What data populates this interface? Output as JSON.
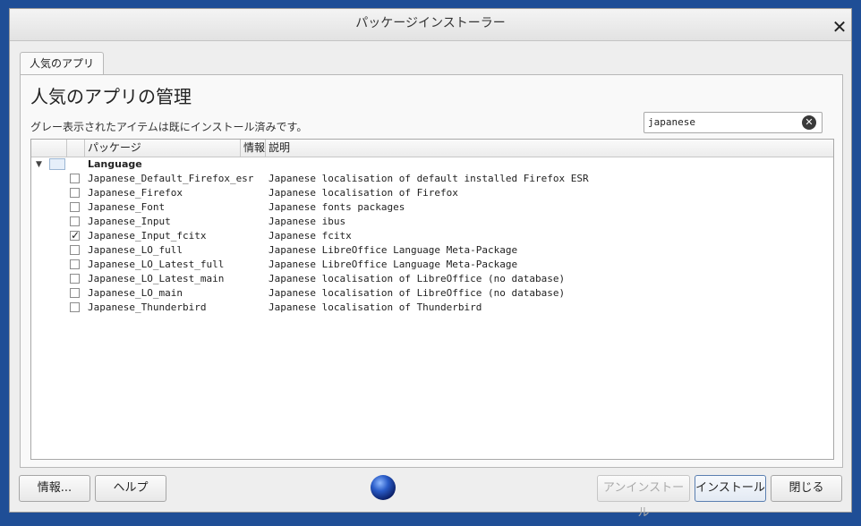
{
  "window": {
    "title": "パッケージインストーラー",
    "close_glyph": "✕"
  },
  "tab": {
    "label": "人気のアプリ"
  },
  "panel": {
    "heading": "人気のアプリの管理",
    "note": "グレー表示されたアイテムは既にインストール済みです。"
  },
  "search": {
    "value": "japanese",
    "clear_icon": "clear-icon"
  },
  "table": {
    "columns": {
      "package": "パッケージ",
      "info": "情報",
      "description": "説明"
    },
    "group": {
      "label": "Language",
      "expanded": true
    },
    "rows": [
      {
        "name": "Japanese_Default_Firefox_esr",
        "desc": "Japanese localisation of default installed Firefox ESR",
        "checked": false
      },
      {
        "name": "Japanese_Firefox",
        "desc": "Japanese localisation of Firefox",
        "checked": false
      },
      {
        "name": "Japanese_Font",
        "desc": "Japanese fonts packages",
        "checked": false
      },
      {
        "name": "Japanese_Input",
        "desc": "Japanese ibus",
        "checked": false
      },
      {
        "name": "Japanese_Input_fcitx",
        "desc": "Japanese fcitx",
        "checked": true
      },
      {
        "name": "Japanese_LO_full",
        "desc": "Japanese LibreOffice Language Meta-Package",
        "checked": false
      },
      {
        "name": "Japanese_LO_Latest_full",
        "desc": "Japanese LibreOffice Language Meta-Package",
        "checked": false
      },
      {
        "name": "Japanese_LO_Latest_main",
        "desc": "Japanese localisation of LibreOffice (no database)",
        "checked": false
      },
      {
        "name": "Japanese_LO_main",
        "desc": "Japanese localisation of LibreOffice (no database)",
        "checked": false
      },
      {
        "name": "Japanese_Thunderbird",
        "desc": "Japanese localisation of Thunderbird",
        "checked": false
      }
    ]
  },
  "buttons": {
    "info": "情報...",
    "help": "ヘルプ",
    "uninstall": "アンインストール",
    "install": "インストール",
    "close": "閉じる"
  },
  "colors": {
    "desktop": "#1f4e96",
    "window_bg": "#eeeeee"
  }
}
